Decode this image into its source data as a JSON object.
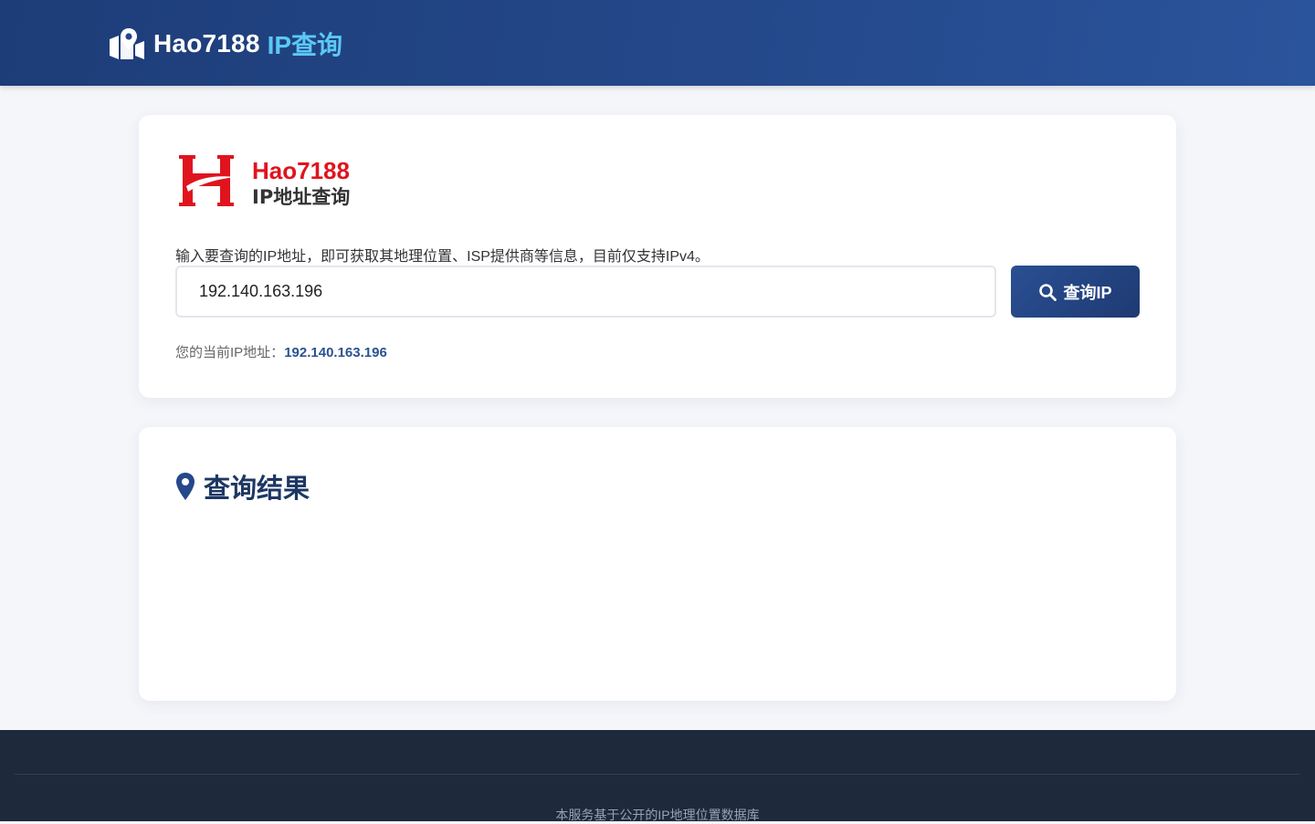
{
  "header": {
    "brand_name": "Hao7188",
    "brand_accent": "IP查询",
    "brand_icon": "map-location-icon"
  },
  "logo": {
    "letter": "H",
    "line1": "Hao7188",
    "line2": "IP地址查询",
    "colors": {
      "red": "#e0141e",
      "dark": "#333333"
    }
  },
  "query": {
    "hint": "输入要查询的IP地址，即可获取其地理位置、ISP提供商等信息，目前仅支持IPv4。",
    "input_value": "192.140.163.196",
    "button_label": "查询IP",
    "button_icon": "search-icon",
    "current_ip_label": "您的当前IP地址：",
    "current_ip_value": "192.140.163.196"
  },
  "result": {
    "title": "查询结果",
    "icon": "map-pin-icon"
  },
  "footer": {
    "text": "本服务基于公开的IP地理位置数据库"
  },
  "colors": {
    "header_bg": "#24488a",
    "accent": "#5bc8f5",
    "primary": "#1e3a72",
    "footer_bg": "#1e293b"
  }
}
